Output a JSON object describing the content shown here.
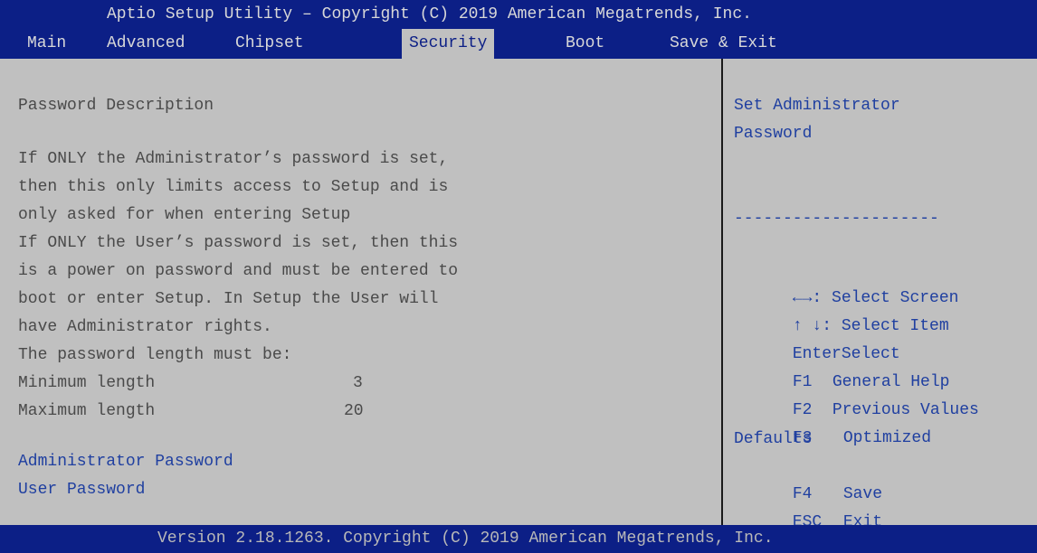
{
  "title": "Aptio Setup Utility – Copyright (C) 2019 American Megatrends, Inc.",
  "menu": {
    "main": "Main",
    "advanced": "Advanced",
    "chipset": "Chipset",
    "security": "Security",
    "boot": "Boot",
    "save_exit": "Save & Exit"
  },
  "main": {
    "heading": "Password Description",
    "description": [
      "If ONLY the Administrator’s password is set,",
      "then this only limits access to Setup and is",
      "only asked for when entering Setup",
      "If ONLY the User’s password is set, then this",
      "is a power on password and must be entered to",
      "boot or enter Setup. In Setup the User will",
      "have Administrator rights.",
      "The password length must be:"
    ],
    "min_label": "Minimum length",
    "min_value": "3",
    "max_label": "Maximum length",
    "max_value": "20",
    "admin_password": "Administrator Password",
    "user_password": "User Password"
  },
  "help": {
    "line1": "Set Administrator",
    "line2": "Password",
    "separator": "---------------------",
    "keys": {
      "select_screen_key": "←→",
      "select_screen": ": Select Screen",
      "select_item_key": "↑ ↓",
      "select_item": ": Select Item",
      "enter_key": "Enter",
      "enter": "Select",
      "f1_key": "F1",
      "f1": "General Help",
      "f2_key": "F2",
      "f2": "Previous Values",
      "f3_key": "F3",
      "f3_line1": "Optimized",
      "f3_line2": "Defaults",
      "f4_key": "F4",
      "f4": "Save",
      "esc_key": "ESC",
      "esc": "Exit"
    }
  },
  "footer": "Version 2.18.1263. Copyright (C) 2019 American Megatrends, Inc.",
  "colors": {
    "header_bg": "#0c1f86",
    "panel_bg": "#c0c0c0",
    "link_blue": "#1f3fa0",
    "text": "#4a4a4a"
  }
}
